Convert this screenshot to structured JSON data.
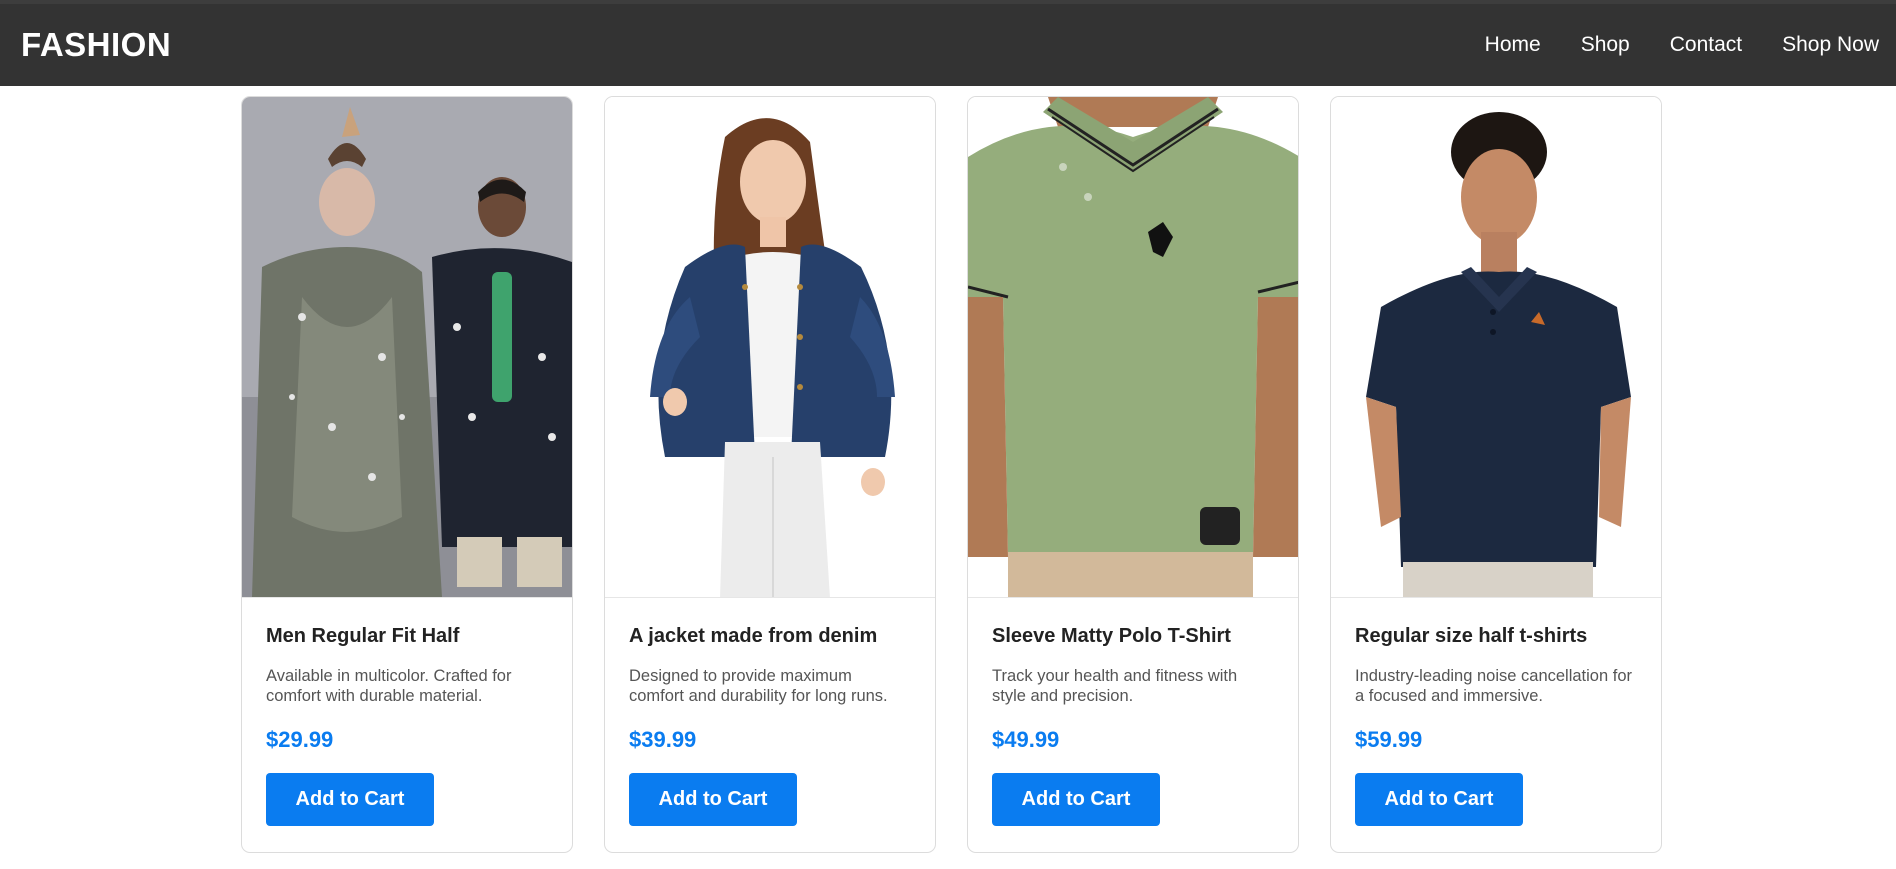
{
  "header": {
    "brand": "FASHION",
    "nav": [
      "Home",
      "Shop",
      "Contact",
      "Shop Now"
    ]
  },
  "products": [
    {
      "title": "Men Regular Fit Half",
      "description": "Available in multicolor. Crafted for comfort with durable material.",
      "price": "$29.99",
      "button": "Add to Cart",
      "image": "two-models-paisley-outfits-photo"
    },
    {
      "title": "A jacket made from denim",
      "description": "Designed to provide maximum comfort and durability for long runs.",
      "price": "$39.99",
      "button": "Add to Cart",
      "image": "woman-denim-jacket-photo"
    },
    {
      "title": "Sleeve Matty Polo T-Shirt",
      "description": "Track your health and fitness with style and precision.",
      "price": "$49.99",
      "button": "Add to Cart",
      "image": "green-polo-shirt-photo"
    },
    {
      "title": "Regular size half t-shirts",
      "description": "Industry-leading noise cancellation for a focused and immersive.",
      "price": "$59.99",
      "button": "Add to Cart",
      "image": "navy-polo-shirt-photo"
    }
  ],
  "colors": {
    "header_bg": "#333333",
    "accent": "#0a7cf0",
    "card_border": "#dcdcdc"
  }
}
